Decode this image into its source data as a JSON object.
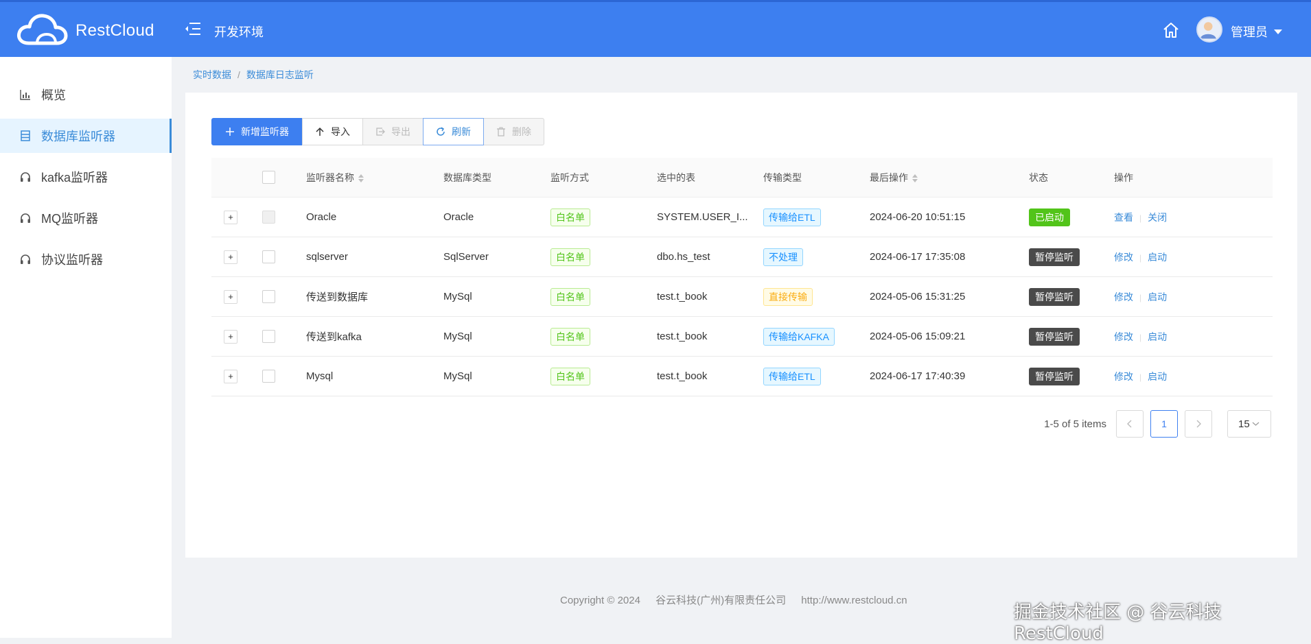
{
  "header": {
    "brand": "RestCloud",
    "env_title": "开发环境",
    "user_name": "管理员"
  },
  "sidebar": {
    "items": [
      {
        "label": "概览",
        "icon": "chart-icon"
      },
      {
        "label": "数据库监听器",
        "icon": "database-icon",
        "active": true
      },
      {
        "label": "kafka监听器",
        "icon": "headphones-icon"
      },
      {
        "label": "MQ监听器",
        "icon": "headphones-icon"
      },
      {
        "label": "协议监听器",
        "icon": "headphones-icon"
      }
    ]
  },
  "breadcrumb": [
    "实时数据",
    "数据库日志监听"
  ],
  "toolbar": {
    "add": "新增监听器",
    "import": "导入",
    "export": "导出",
    "refresh": "刷新",
    "delete": "删除"
  },
  "table": {
    "columns": [
      "监听器名称",
      "数据库类型",
      "监听方式",
      "选中的表",
      "传输类型",
      "最后操作",
      "状态",
      "操作"
    ],
    "rows": [
      {
        "name": "Oracle",
        "db": "Oracle",
        "mode": "白名单",
        "table": "SYSTEM.USER_I...",
        "trans": "传输给ETL",
        "trans_color": "blue",
        "last": "2024-06-20 10:51:15",
        "status": "已启动",
        "status_color": "green",
        "op1": "查看",
        "op2": "关闭"
      },
      {
        "name": "sqlserver",
        "db": "SqlServer",
        "mode": "白名单",
        "table": "dbo.hs_test",
        "trans": "不处理",
        "trans_color": "blue",
        "last": "2024-06-17 17:35:08",
        "status": "暂停监听",
        "status_color": "dark",
        "op1": "修改",
        "op2": "启动"
      },
      {
        "name": "传送到数据库",
        "db": "MySql",
        "mode": "白名单",
        "table": "test.t_book",
        "trans": "直接传输",
        "trans_color": "orange",
        "last": "2024-05-06 15:31:25",
        "status": "暂停监听",
        "status_color": "dark",
        "op1": "修改",
        "op2": "启动"
      },
      {
        "name": "传送到kafka",
        "db": "MySql",
        "mode": "白名单",
        "table": "test.t_book",
        "trans": "传输给KAFKA",
        "trans_color": "blue",
        "last": "2024-05-06 15:09:21",
        "status": "暂停监听",
        "status_color": "dark",
        "op1": "修改",
        "op2": "启动"
      },
      {
        "name": "Mysql",
        "db": "MySql",
        "mode": "白名单",
        "table": "test.t_book",
        "trans": "传输给ETL",
        "trans_color": "blue",
        "last": "2024-06-17 17:40:39",
        "status": "暂停监听",
        "status_color": "dark",
        "op1": "修改",
        "op2": "启动"
      }
    ]
  },
  "pagination": {
    "total_text": "1-5 of 5 items",
    "current": "1",
    "page_size": "15"
  },
  "footer": {
    "copyright": "Copyright © 2024",
    "company": "谷云科技(广州)有限责任公司",
    "url": "http://www.restcloud.cn"
  },
  "watermark": "掘金技术社区 @ 谷云科技RestCloud"
}
